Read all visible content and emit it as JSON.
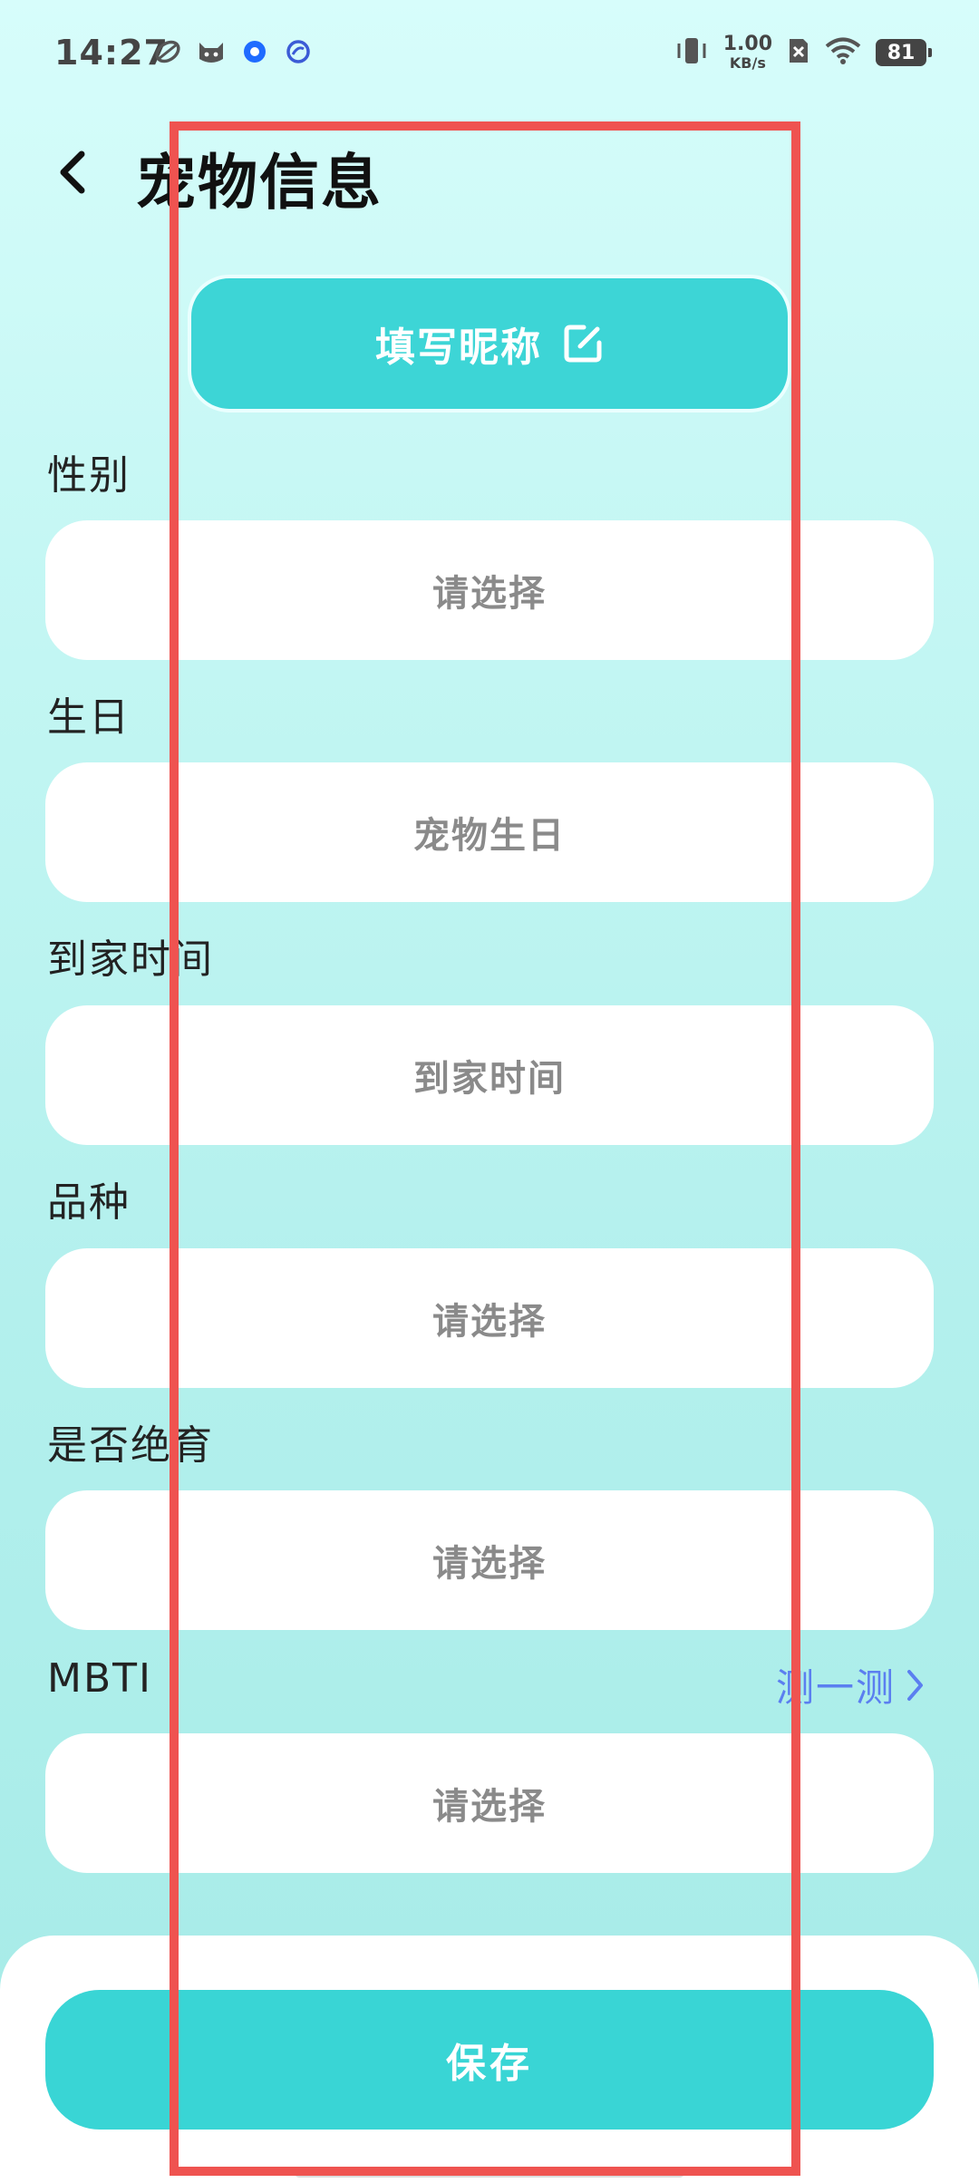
{
  "status_bar": {
    "time": "14:27",
    "net_speed_value": "1.00",
    "net_speed_unit": "KB/s",
    "battery": "81",
    "left_icons": [
      "leaf-app-icon",
      "cat-app-icon",
      "blue-dot-app-icon",
      "ring-app-icon"
    ],
    "right_icons": [
      "vibrate-icon",
      "sim-off-icon",
      "wifi-icon",
      "battery-icon"
    ]
  },
  "header": {
    "title": "宠物信息",
    "back_icon": "chevron-left-icon"
  },
  "nickname": {
    "label": "填写昵称",
    "icon": "edit-icon"
  },
  "form": {
    "fields": [
      {
        "label": "性别",
        "placeholder": "请选择"
      },
      {
        "label": "生日",
        "placeholder": "宠物生日"
      },
      {
        "label": "到家时间",
        "placeholder": "到家时间"
      },
      {
        "label": "品种",
        "placeholder": "请选择"
      },
      {
        "label": "是否绝育",
        "placeholder": "请选择"
      },
      {
        "label": "MBTI",
        "placeholder": "请选择"
      }
    ],
    "mbti_test_link": "测一测"
  },
  "footer": {
    "save_label": "保存"
  },
  "colors": {
    "accent": "#39d5d5",
    "link": "#5b7ff0",
    "annotation": "#ef5350"
  }
}
